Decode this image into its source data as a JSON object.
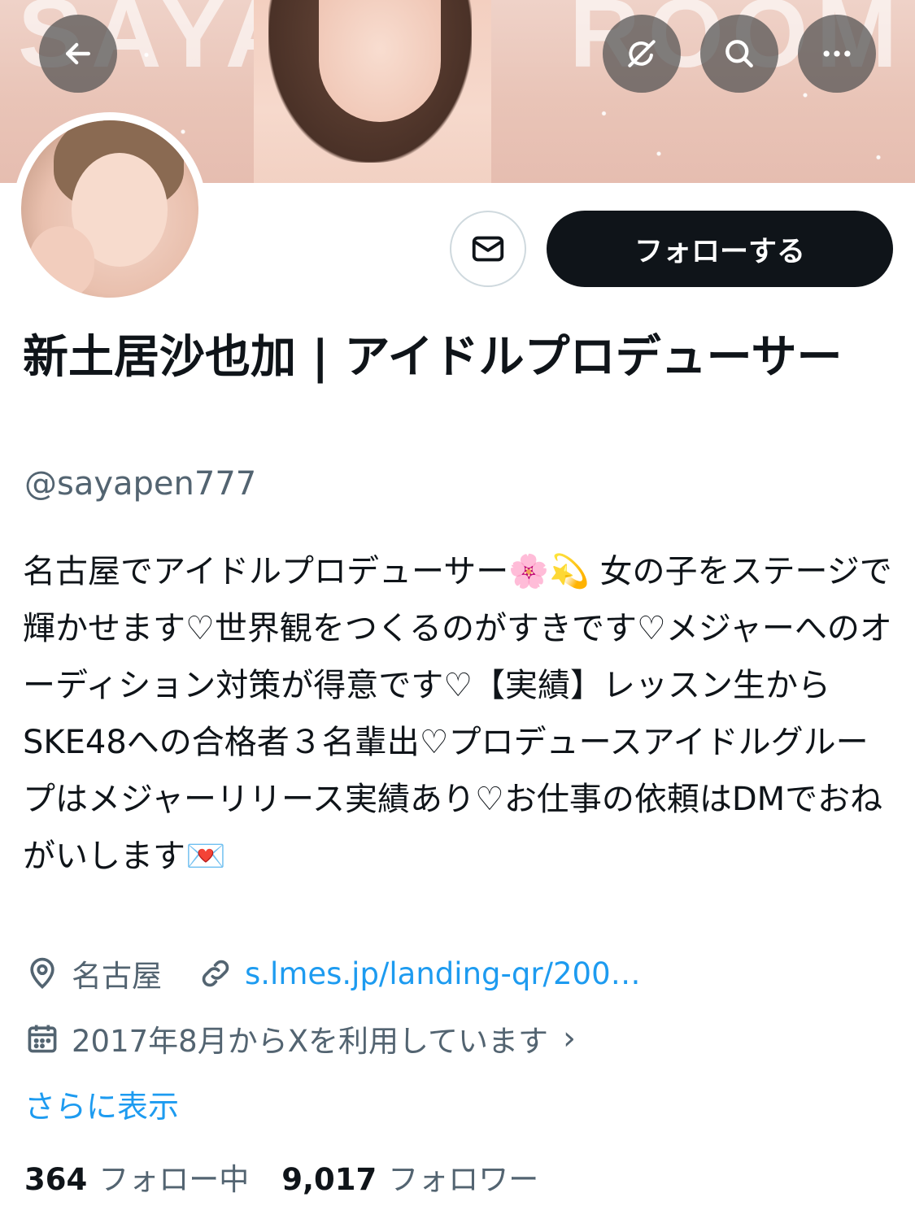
{
  "header": {
    "back_icon": "arrow-left-icon",
    "grok_icon": "grok-icon",
    "search_icon": "search-icon",
    "more_icon": "more-horizontal-icon",
    "banner_text_left": "SAYA",
    "banner_text_right": "ROOM"
  },
  "actions": {
    "dm_icon": "mail-icon",
    "follow_label": "フォローする"
  },
  "profile": {
    "display_name": "新土居沙也加 | アイドルプロデューサー",
    "handle": "@sayapen777",
    "bio": "名古屋でアイドルプロデューサー🌸💫 女の子をステージで輝かせます♡世界観をつくるのがすきです♡メジャーへのオーディション対策が得意です♡【実績】レッスン生からSKE48への合格者３名輩出♡プロデュースアイドルグループはメジャーリリース実績あり♡お仕事の依頼はDMでおねがいします💌",
    "location": "名古屋",
    "website": "s.lmes.jp/landing-qr/200…",
    "joined": "2017年8月からXを利用しています",
    "show_more": "さらに表示"
  },
  "stats": {
    "following_count": "364",
    "following_label": "フォロー中",
    "followers_count": "9,017",
    "followers_label": "フォロワー"
  },
  "colors": {
    "link": "#1d9bf0",
    "secondary_text": "#536471",
    "primary_text": "#0f1419",
    "follow_button_bg": "#0f1419"
  }
}
